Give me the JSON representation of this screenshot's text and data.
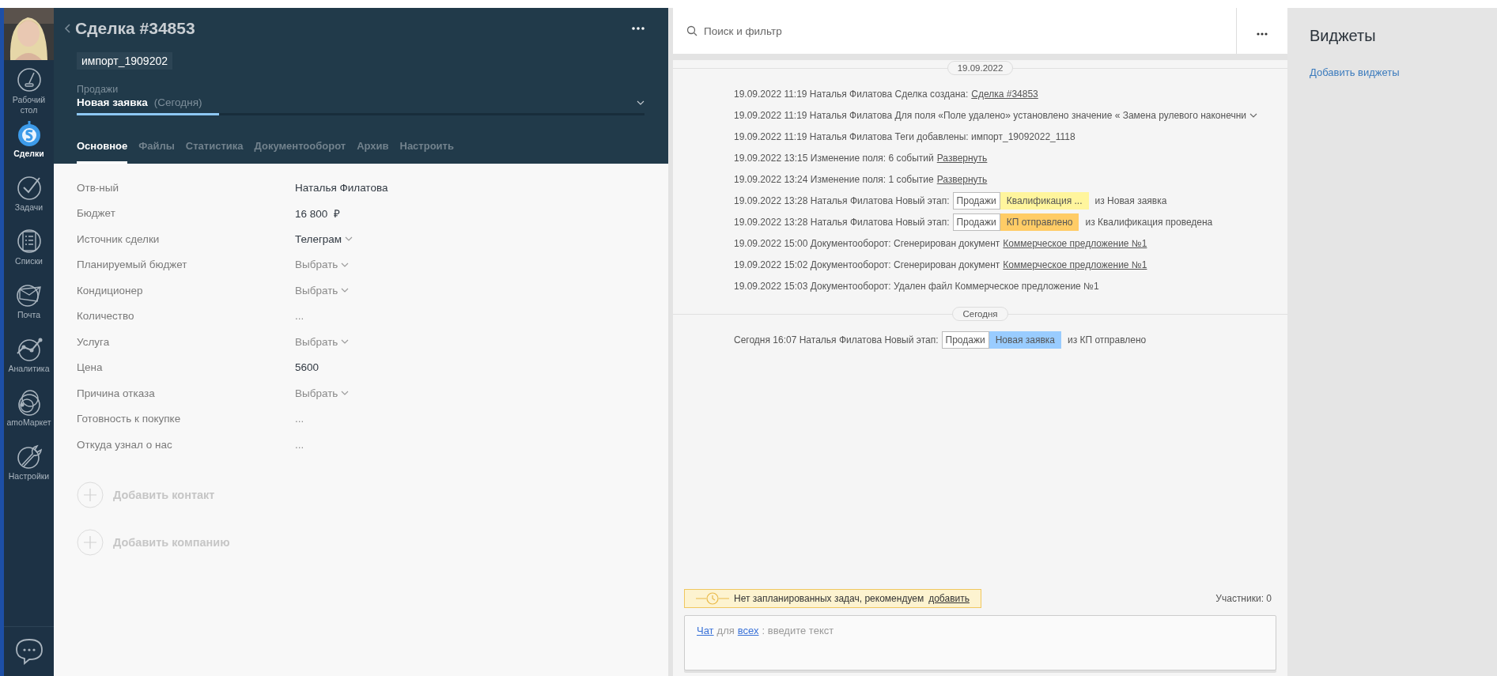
{
  "sidebar": {
    "items": [
      {
        "label": "Рабочий стол",
        "selected": false
      },
      {
        "label": "Сделки",
        "selected": true
      },
      {
        "label": "Задачи",
        "selected": false
      },
      {
        "label": "Списки",
        "selected": false
      },
      {
        "label": "Почта",
        "selected": false
      },
      {
        "label": "Аналитика",
        "selected": false
      },
      {
        "label": "amoМаркет",
        "selected": false
      },
      {
        "label": "Настройки",
        "selected": false
      }
    ]
  },
  "deal": {
    "title": "Сделка #34853",
    "tag": "импорт_1909202",
    "pipeline": "Продажи",
    "stage": "Новая заявка",
    "stage_date": "(Сегодня)",
    "level": 0.25,
    "tabs": [
      {
        "label": "Основное",
        "selected": true
      },
      {
        "label": "Файлы",
        "selected": false
      },
      {
        "label": "Статистика",
        "selected": false
      },
      {
        "label": "Документооборот",
        "selected": false
      },
      {
        "label": "Архив",
        "selected": false
      },
      {
        "label": "Настроить",
        "selected": false
      }
    ],
    "fields": [
      {
        "label": "Отв-ный",
        "value": "Наталья Филатова",
        "kind": "text"
      },
      {
        "label": "Бюджет",
        "value": "16 800  ₽",
        "kind": "text"
      },
      {
        "label": "Источник сделки",
        "value": "Телеграм",
        "kind": "select"
      },
      {
        "label": "Планируемый бюджет",
        "value": "Выбрать",
        "kind": "choose"
      },
      {
        "label": "Кондиционер",
        "value": "Выбрать",
        "kind": "choose"
      },
      {
        "label": "Количество",
        "value": "...",
        "kind": "empty"
      },
      {
        "label": "Услуга",
        "value": "Выбрать",
        "kind": "choose"
      },
      {
        "label": "Цена",
        "value": "5600",
        "kind": "text"
      },
      {
        "label": "Причина отказа",
        "value": "Выбрать",
        "kind": "choose"
      },
      {
        "label": "Готовность к покупке",
        "value": "...",
        "kind": "empty"
      },
      {
        "label": "Откуда узнал о нас",
        "value": "...",
        "kind": "empty"
      }
    ],
    "add_links": [
      "Добавить контакт",
      "Добавить компанию"
    ]
  },
  "feed": {
    "search": {
      "placeholder": "Поиск и фильтр"
    },
    "groups": [
      {
        "date": "19.09.2022",
        "events": [
          {
            "lead": "19.09.2022 11:19 Наталья Филатова Сделка создана:",
            "link": "Сделка #34853",
            "expandable": false
          },
          {
            "lead": "19.09.2022 11:19 Наталья Филатова Для поля «Поле удалено» установлено значение « Замена рулевого наконечни",
            "expandable": true
          },
          {
            "lead": "19.09.2022 11:19 Наталья Филатова Теги добавлены: импорт_19092022_1118",
            "expandable": false
          },
          {
            "lead": "19.09.2022 13:15 Изменение поля: 6 событий",
            "link": "Развернуть",
            "expandable": false
          },
          {
            "lead": "19.09.2022 13:24 Изменение поля: 1 событие",
            "link": "Развернуть",
            "expandable": false
          },
          {
            "lead": "19.09.2022 13:28 Наталья Филатова Новый этап:",
            "stage": {
              "pipeline": "Продажи",
              "name": "Квалификация ...",
              "color": "#fff59d"
            },
            "tail": "из Новая заявка",
            "expandable": false
          },
          {
            "lead": "19.09.2022 13:28 Наталья Филатова Новый этап:",
            "stage": {
              "pipeline": "Продажи",
              "name": "КП отправлено",
              "color": "#ffcc66"
            },
            "tail": "из Квалификация проведена",
            "expandable": false
          },
          {
            "lead": "19.09.2022 15:00 Документооборот: Сгенерирован документ",
            "link": "Коммерческое предложение №1",
            "expandable": false
          },
          {
            "lead": "19.09.2022 15:02 Документооборот: Сгенерирован документ",
            "link": "Коммерческое предложение №1",
            "expandable": false
          },
          {
            "lead": "19.09.2022 15:03 Документооборот: Удален файл Коммерческое предложение №1",
            "expandable": false
          }
        ]
      },
      {
        "date": "Сегодня",
        "events": [
          {
            "lead": "Сегодня 16:07 Наталья Филатова Новый этап:",
            "stage": {
              "pipeline": "Продажи",
              "name": "Новая заявка",
              "color": "#99ccff"
            },
            "tail": "из КП отправлено",
            "expandable": false
          }
        ]
      }
    ],
    "notice": {
      "text": "Нет запланированных задач, рекомендуем",
      "link": "добавить"
    },
    "participants": "Участники: 0",
    "chat": [
      {
        "kind": "link",
        "text": "Чат"
      },
      {
        "kind": "text",
        "text": "для"
      },
      {
        "kind": "link",
        "text": "всех"
      },
      {
        "kind": "text",
        "text": ": введите текст"
      }
    ]
  },
  "widgets": {
    "title": "Виджеты",
    "link": "Добавить виджеты"
  }
}
